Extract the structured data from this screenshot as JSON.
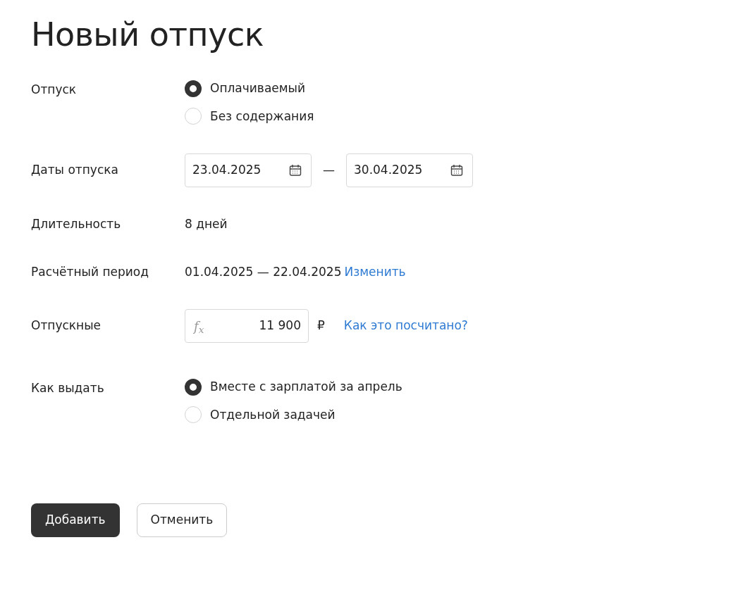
{
  "title": "Новый отпуск",
  "leave_type": {
    "label": "Отпуск",
    "options": [
      {
        "label": "Оплачиваемый",
        "selected": true
      },
      {
        "label": "Без содержания",
        "selected": false
      }
    ]
  },
  "dates": {
    "label": "Даты отпуска",
    "from": "23.04.2025",
    "separator": "—",
    "to": "30.04.2025"
  },
  "duration": {
    "label": "Длительность",
    "value": "8 дней"
  },
  "period": {
    "label": "Расчётный период",
    "value": "01.04.2025 — 22.04.2025",
    "link": "Изменить"
  },
  "pay": {
    "label": "Отпускные",
    "formula_mark": "f$_{x}$",
    "value": "11 900",
    "currency": "₽",
    "link": "Как это посчитано?"
  },
  "payout": {
    "label": "Как выдать",
    "options": [
      {
        "label": "Вместе с зарплатой за апрель",
        "selected": true
      },
      {
        "label": "Отдельной задачей",
        "selected": false
      }
    ]
  },
  "buttons": [
    {
      "label": "Добавить",
      "kind": "primary"
    },
    {
      "label": "Отменить",
      "kind": "secondary"
    }
  ]
}
